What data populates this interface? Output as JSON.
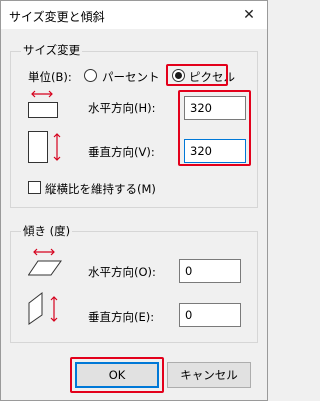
{
  "window": {
    "title": "サイズ変更と傾斜",
    "close_label": "✕"
  },
  "resize": {
    "group_label": "サイズ変更",
    "unit_label": "単位(B):",
    "percent_label": "パーセント",
    "pixel_label": "ピクセル",
    "selected_unit": "pixel",
    "horizontal_label": "水平方向(H):",
    "horizontal_value": "320",
    "vertical_label": "垂直方向(V):",
    "vertical_value": "320",
    "keep_aspect_label": "縦横比を維持する(M)",
    "keep_aspect_checked": false
  },
  "skew": {
    "group_label": "傾き (度)",
    "horizontal_label": "水平方向(O):",
    "horizontal_value": "0",
    "vertical_label": "垂直方向(E):",
    "vertical_value": "0"
  },
  "buttons": {
    "ok_label": "OK",
    "cancel_label": "キャンセル"
  },
  "colors": {
    "highlight": "#e3001b",
    "focus": "#0078d7",
    "arrow": "#d6001c"
  }
}
